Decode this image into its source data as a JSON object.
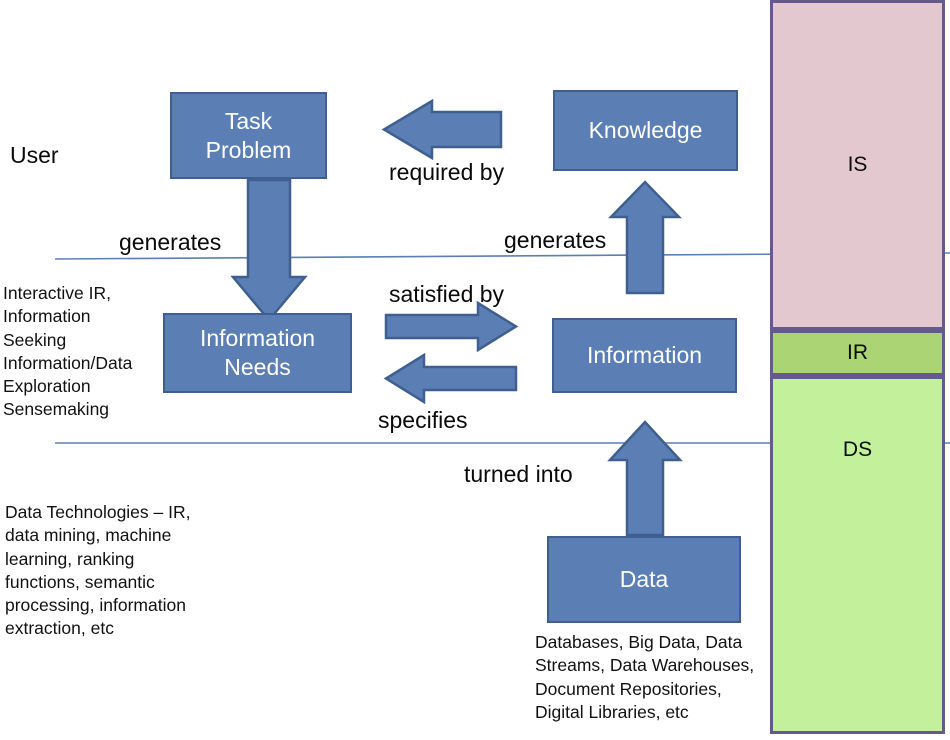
{
  "diagram": {
    "title": "Information Seeking / IR / Data Science conceptual model",
    "colors": {
      "box_fill": "#5b7fb4",
      "box_stroke": "#3e5f8f",
      "arrow_fill": "#5b7fb4",
      "arrow_stroke": "#3e5f8f",
      "is_panel": "#e3c8cf",
      "ir_panel": "#abd475",
      "ds_panel": "#c3f09a",
      "panel_stroke": "#66598c",
      "separator_line": "#5b7fb4"
    }
  },
  "boxes": {
    "task_problem": "Task\nProblem",
    "knowledge": "Knowledge",
    "information_needs": "Information\nNeeds",
    "information": "Information",
    "data": "Data"
  },
  "relations": {
    "required_by": "required by",
    "generates_left": "generates",
    "generates_right": "generates",
    "satisfied_by": "satisfied by",
    "specifies": "specifies",
    "turned_into": "turned into"
  },
  "annotations": {
    "user": "User",
    "user_layer_techniques": "Interactive IR,\nInformation\nSeeking\nInformation/Data\nExploration\nSensemaking",
    "data_technologies": "Data Technologies – IR,\ndata mining, machine\nlearning, ranking\nfunctions, semantic\nprocessing, information\nextraction, etc",
    "data_sources": "Databases, Big Data, Data\nStreams, Data Warehouses,\nDocument Repositories,\nDigital Libraries, etc"
  },
  "panels": {
    "is": "IS",
    "ir": "IR",
    "ds": "DS"
  }
}
